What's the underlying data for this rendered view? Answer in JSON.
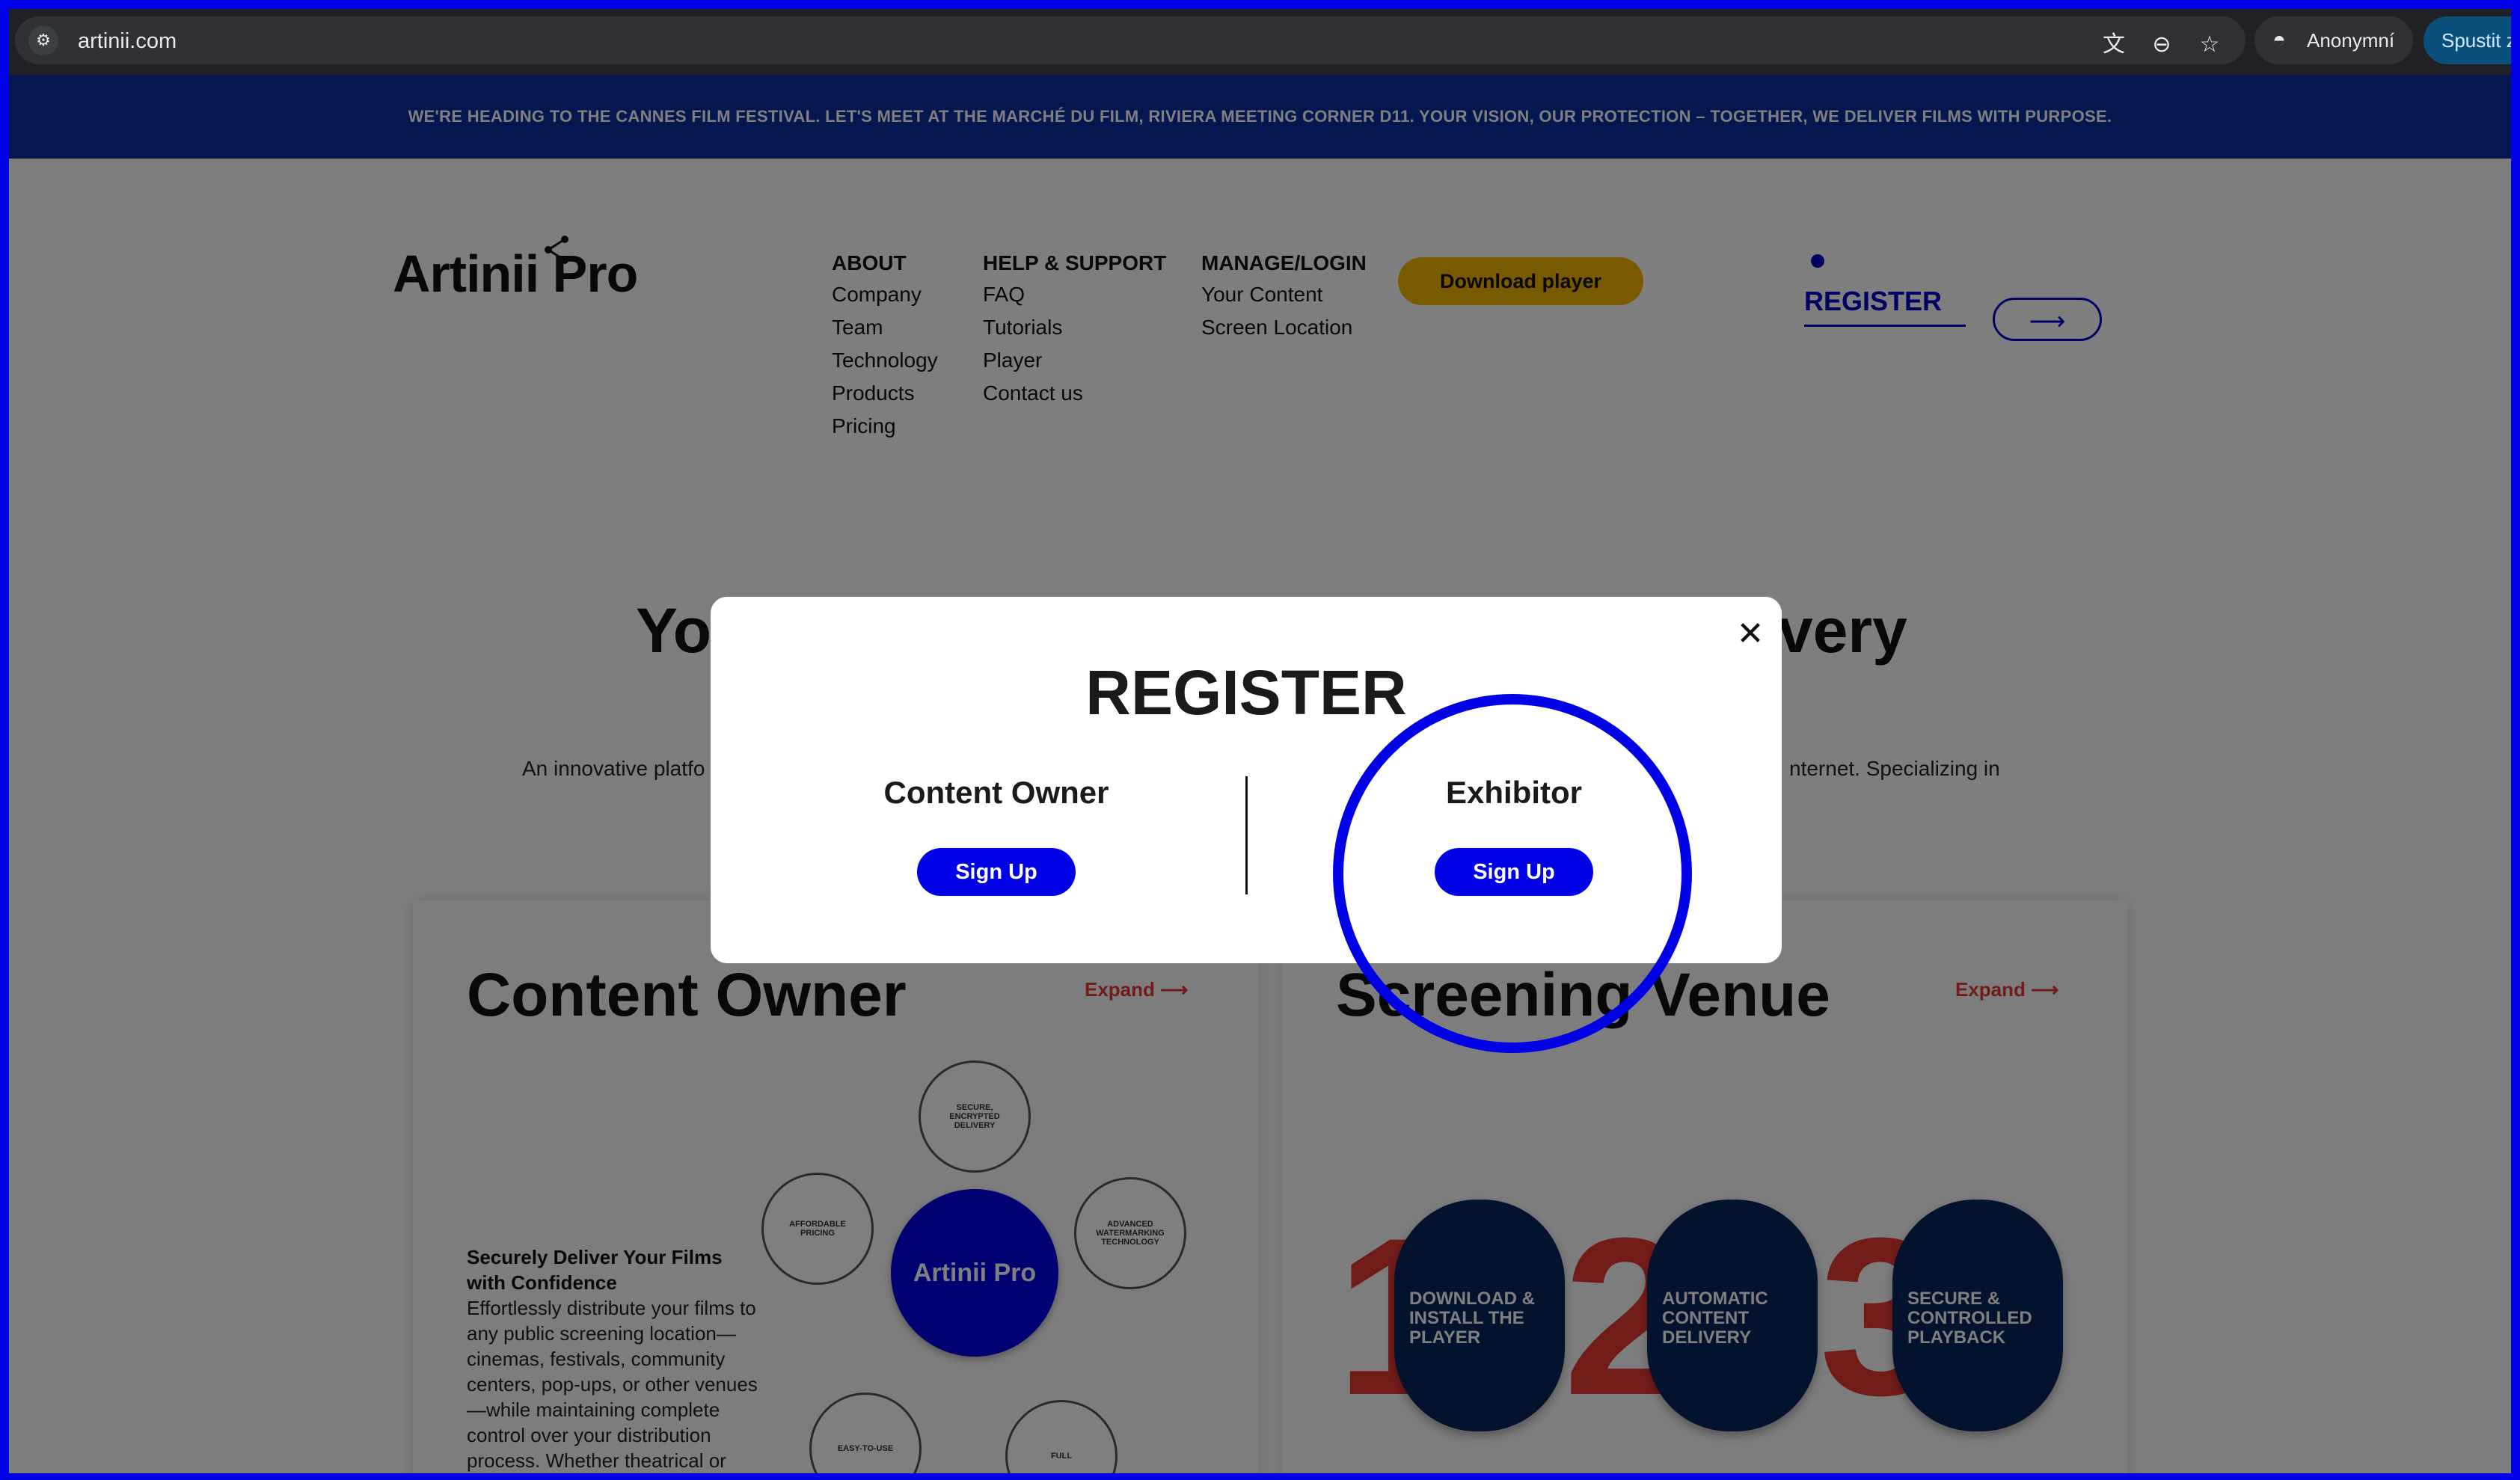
{
  "browser": {
    "url": "artinii.com",
    "profile_label": "Anonymní",
    "launch_label": "Spustit zne",
    "icons": [
      "site-info-icon",
      "translate-icon",
      "zoom-out-icon",
      "bookmark-star-icon",
      "incognito-icon"
    ]
  },
  "banner": {
    "text": "WE'RE HEADING TO THE CANNES FILM FESTIVAL. LET'S MEET AT THE MARCHÉ DU FILM, RIVIERA MEETING CORNER D11. YOUR VISION, OUR PROTECTION – TOGETHER, WE DELIVER FILMS WITH PURPOSE."
  },
  "header": {
    "logo_text": "Artinii Pro",
    "nav": [
      {
        "heading": "ABOUT",
        "links": [
          "Company",
          "Team",
          "Technology",
          "Products",
          "Pricing"
        ]
      },
      {
        "heading": "HELP & SUPPORT",
        "links": [
          "FAQ",
          "Tutorials",
          "Player",
          "Contact us"
        ]
      },
      {
        "heading": "MANAGE/LOGIN",
        "links": [
          "Your Content",
          "Screen Location"
        ]
      }
    ],
    "download_label": "Download player",
    "register_label": "REGISTER",
    "arrow_label": "⟶"
  },
  "hero": {
    "title_left": "Yo",
    "title_right": "very",
    "subtitle_left": "An innovative platfo",
    "subtitle_right": "nternet. Specializing in"
  },
  "cards": {
    "content_owner": {
      "title": "Content Owner",
      "expand": "Expand ⟶",
      "feature_title": "Securely Deliver Your Films with Confidence",
      "feature_body": "Effortlessly distribute your films to any public screening location—cinemas, festivals, community centers, pop-ups, or other venues—while maintaining complete control over your distribution process. Whether theatrical or",
      "hub_label": "Artinii Pro",
      "bubbles": [
        "SECURE, ENCRYPTED DELIVERY",
        "AFFORDABLE PRICING",
        "ADVANCED WATERMARKING TECHNOLOGY",
        "EASY-TO-USE",
        "FULL"
      ]
    },
    "screening_venue": {
      "title": "Screening Venue",
      "expand": "Expand ⟶",
      "steps": [
        {
          "num": "1",
          "label": "DOWNLOAD & INSTALL THE PLAYER"
        },
        {
          "num": "2",
          "label": "AUTOMATIC CONTENT DELIVERY"
        },
        {
          "num": "3",
          "label": "SECURE & CONTROLLED PLAYBACK"
        }
      ]
    }
  },
  "modal": {
    "title": "REGISTER",
    "close": "✕",
    "options": [
      {
        "heading": "Content Owner",
        "button": "Sign Up"
      },
      {
        "heading": "Exhibitor",
        "button": "Sign Up"
      }
    ]
  },
  "colors": {
    "frame_highlight": "#0000e6",
    "banner": "#0c2fa0",
    "accent_yellow": "#f4b400",
    "accent_red": "#e53935",
    "step_navy": "#07265a"
  }
}
